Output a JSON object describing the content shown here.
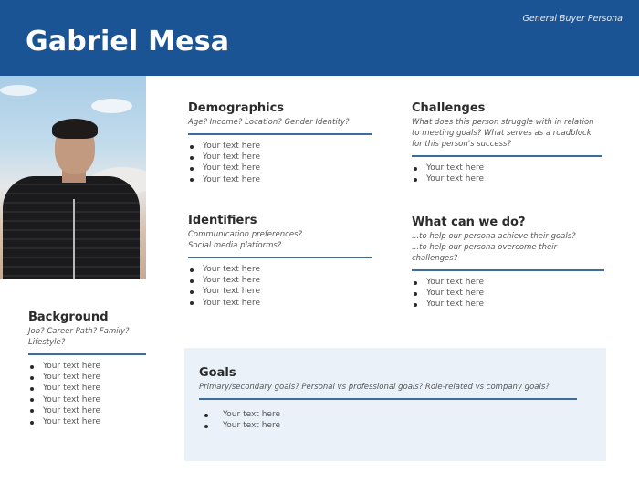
{
  "header": {
    "name": "Gabriel Mesa",
    "subtitle": "General Buyer Persona",
    "background_color": "#1a5494"
  },
  "photo": {
    "description": "Portrait of a young man with dark hair in a black striped zip jacket, outdoor background"
  },
  "sections": {
    "demographics": {
      "title": "Demographics",
      "prompt": "Age? Income? Location? Gender Identity?",
      "items": [
        "Your text here",
        "Your text here",
        "Your text here",
        "Your text here"
      ]
    },
    "challenges": {
      "title": "Challenges",
      "prompt": "What does this person struggle with in relation to meeting goals? What serves as a roadblock for this person's success?",
      "items": [
        "Your text here",
        "Your text here"
      ]
    },
    "identifiers": {
      "title": "Identifiers",
      "prompt_lines": [
        "Communication preferences?",
        "Social media platforms?"
      ],
      "items": [
        "Your text here",
        "Your text here",
        "Your text here",
        "Your text here"
      ]
    },
    "what_can_we_do": {
      "title": "What can we do?",
      "prompt_lines": [
        "...to help our persona achieve their goals?",
        "...to help our persona overcome their challenges?"
      ],
      "items": [
        "Your text here",
        "Your text here",
        "Your text here"
      ]
    },
    "background": {
      "title": "Background",
      "prompt": "Job? Career Path? Family? Lifestyle?",
      "items": [
        "Your text here",
        "Your text here",
        "Your text here",
        "Your text here",
        "Your text here",
        "Your text here"
      ]
    },
    "goals": {
      "title": "Goals",
      "prompt": "Primary/secondary goals?  Personal vs professional goals? Role-related vs company goals?",
      "items": [
        "Your text here",
        "Your text here"
      ]
    }
  },
  "colors": {
    "accent_rule": "#3d6c9e",
    "goals_background": "#eaf1f9"
  }
}
